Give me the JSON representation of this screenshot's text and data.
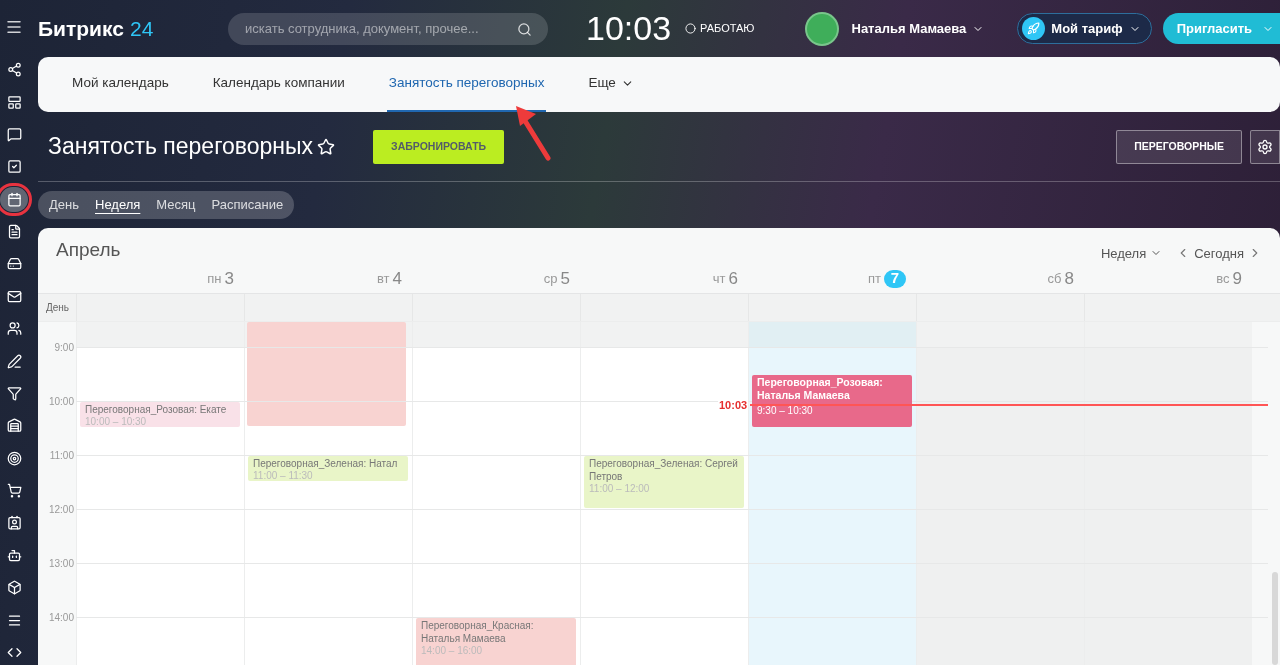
{
  "header": {
    "logo": {
      "name": "Битрикс",
      "number": "24"
    },
    "search": {
      "placeholder": "искать сотрудника, документ, прочее..."
    },
    "clock": "10:03",
    "status": "РАБОТАЮ",
    "user": {
      "name": "Наталья Мамаева"
    },
    "plan_button": "Мой тариф",
    "invite_button": "Пригласить"
  },
  "sidebar": {
    "items": [
      {
        "selected": false
      },
      {
        "selected": false
      },
      {
        "selected": false
      },
      {
        "selected": false
      },
      {
        "selected": true
      },
      {
        "selected": false
      },
      {
        "selected": false
      },
      {
        "selected": false
      },
      {
        "selected": false
      },
      {
        "selected": false
      },
      {
        "selected": false
      },
      {
        "selected": false
      },
      {
        "selected": false
      },
      {
        "selected": false
      },
      {
        "selected": false
      },
      {
        "selected": false
      },
      {
        "selected": false
      },
      {
        "selected": false
      },
      {
        "selected": false
      }
    ]
  },
  "tabs": [
    {
      "label": "Мой календарь",
      "selected": false,
      "dropdown": false
    },
    {
      "label": "Календарь компании",
      "selected": false,
      "dropdown": false
    },
    {
      "label": "Занятость переговорных",
      "selected": true,
      "dropdown": false
    },
    {
      "label": "Еще",
      "selected": false,
      "dropdown": true
    }
  ],
  "page": {
    "title": "Занятость переговорных",
    "book_button": "ЗАБРОНИРОВАТЬ",
    "rooms_button": "ПЕРЕГОВОРНЫЕ"
  },
  "views": [
    {
      "label": "День",
      "selected": false
    },
    {
      "label": "Неделя",
      "selected": true
    },
    {
      "label": "Месяц",
      "selected": false
    },
    {
      "label": "Расписание",
      "selected": false
    }
  ],
  "calendar": {
    "month": "Апрель",
    "view_select": "Неделя",
    "today_button": "Сегодня",
    "all_day_label": "День",
    "now": "10:03",
    "hours": [
      "9:00",
      "10:00",
      "11:00",
      "12:00",
      "13:00",
      "14:00"
    ],
    "days": [
      {
        "weekday": "пн",
        "day": "3",
        "today": false,
        "weekend": false,
        "events": [
          {
            "title": "Переговорная_Розовая: Екате",
            "time": "10:00 – 10:30",
            "color": "#f9e1e8",
            "kind": "muted"
          }
        ]
      },
      {
        "weekday": "вт",
        "day": "4",
        "today": false,
        "weekend": false,
        "events": [
          {
            "title": "Переговорная_Зеленая: Натал",
            "time": "11:00 – 11:30",
            "color": "#e9f5c8",
            "kind": "muted"
          }
        ]
      },
      {
        "weekday": "ср",
        "day": "5",
        "today": false,
        "weekend": false,
        "events": [
          {
            "title": "Переговорная_Красная: Наталья Мамаева",
            "time": "14:00 – 16:00",
            "color": "#f8d3d1",
            "kind": "muted"
          }
        ]
      },
      {
        "weekday": "чт",
        "day": "6",
        "today": false,
        "weekend": false,
        "events": [
          {
            "title": "Переговорная_Зеленая: Сергей Петров",
            "time": "11:00 – 12:00",
            "color": "#e9f5c8",
            "kind": "muted"
          }
        ]
      },
      {
        "weekday": "пт",
        "day": "7",
        "today": true,
        "weekend": false,
        "events": [
          {
            "title": "Переговорная_Розовая: Наталья Мамаева",
            "time": "9:30 – 10:30",
            "color": "#e8698a",
            "kind": "solid"
          }
        ]
      },
      {
        "weekday": "сб",
        "day": "8",
        "today": false,
        "weekend": true
      },
      {
        "weekday": "вс",
        "day": "9",
        "today": false,
        "weekend": true
      }
    ]
  }
}
